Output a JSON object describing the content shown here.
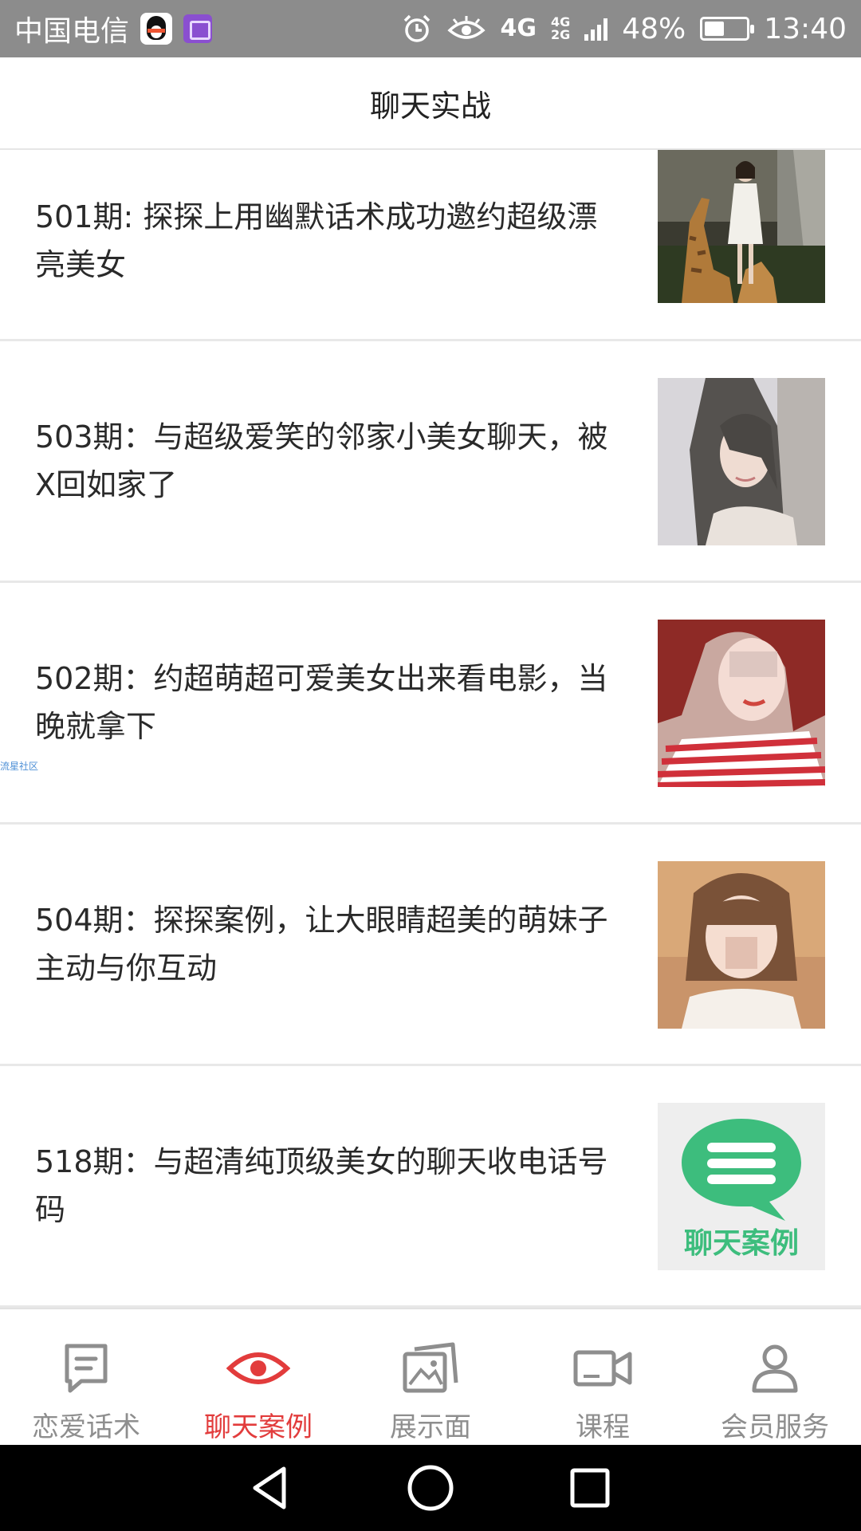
{
  "status_bar": {
    "carrier": "中国电信",
    "network": "4G",
    "network_secondary_top": "4G",
    "network_secondary_bottom": "2G",
    "battery_percent": "48%",
    "battery_level": 0.48,
    "time": "13:40",
    "icons": [
      "qq-icon",
      "gallery-icon",
      "alarm-icon",
      "eye-icon",
      "signal-icon",
      "battery-icon"
    ]
  },
  "header": {
    "title": "聊天实战"
  },
  "articles": [
    {
      "title": "501期: 探探上用幽默话术成功邀约超级漂亮美女",
      "thumb": "photo-girl-giraffes"
    },
    {
      "title": "503期：与超级爱笑的邻家小美女聊天，被X回如家了",
      "thumb": "photo-girl-long-hair"
    },
    {
      "title": "502期：约超萌超可爱美女出来看电影，当晚就拿下",
      "thumb": "photo-girl-red-stripes"
    },
    {
      "title": "504期：探探案例，让大眼睛超美的萌妹子主动与你互动",
      "thumb": "photo-girl-bob-hair"
    },
    {
      "title": "518期：与超清纯顶级美女的聊天收电话号码",
      "thumb": "chat-case-logo"
    }
  ],
  "chat_case_logo_text": "聊天案例",
  "watermark": "流星社区",
  "bottom_nav": [
    {
      "label": "恋爱话术",
      "icon": "message-icon",
      "active": false
    },
    {
      "label": "聊天案例",
      "icon": "eye-icon",
      "active": true
    },
    {
      "label": "展示面",
      "icon": "photos-icon",
      "active": false
    },
    {
      "label": "课程",
      "icon": "video-camera-icon",
      "active": false
    },
    {
      "label": "会员服务",
      "icon": "user-icon",
      "active": false
    }
  ],
  "colors": {
    "status_bar": "#8c8c8c",
    "accent": "#e23c3c",
    "nav_inactive": "#8e8e8e",
    "logo_green": "#3dbd7d"
  }
}
